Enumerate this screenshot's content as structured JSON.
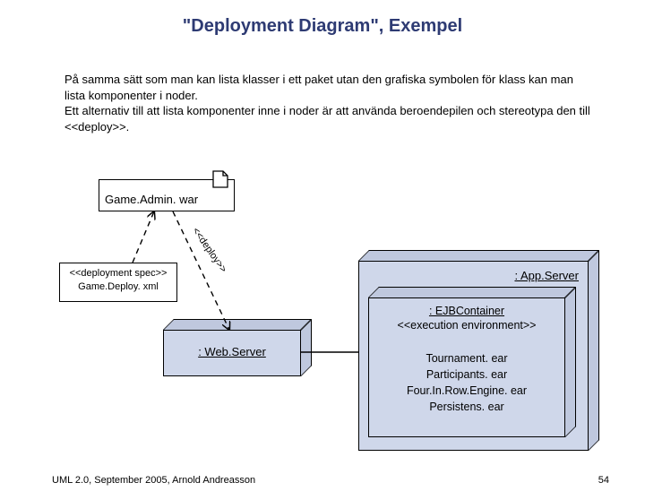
{
  "title": "\"Deployment Diagram\", Exempel",
  "paragraph1": "På samma sätt som man kan lista klasser i ett paket utan den grafiska symbolen för klass kan man lista komponenter i noder.",
  "paragraph2": "Ett alternativ till att lista komponenter inne i noder är att använda beroendepilen och stereotypa den till <<deploy>>.",
  "artifact": {
    "name": "Game.Admin. war"
  },
  "deployspec": {
    "stereotype": "<<deployment spec>>",
    "name": "Game.Deploy. xml"
  },
  "edges": {
    "deploy_label": "<<deploy>>"
  },
  "nodes": {
    "appserver": ": App.Server",
    "ejb": {
      "name": ": EJBContainer",
      "stereotype": "<<execution environment>>"
    },
    "ears": [
      "Tournament. ear",
      "Participants. ear",
      "Four.In.Row.Engine. ear",
      "Persistens. ear"
    ],
    "webserver": ": Web.Server"
  },
  "footer": {
    "left": "UML 2.0, September 2005, Arnold Andreasson",
    "page": "54"
  }
}
